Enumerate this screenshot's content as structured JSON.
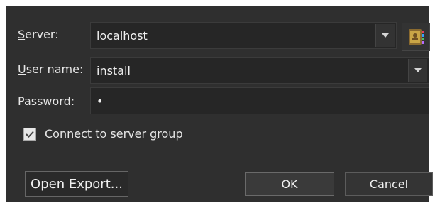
{
  "form": {
    "server": {
      "label_mnemonic": "S",
      "label_rest": "erver:",
      "value": "localhost"
    },
    "username": {
      "label_mnemonic": "U",
      "label_rest": "ser name:",
      "value": "install"
    },
    "password": {
      "label_mnemonic": "P",
      "label_rest": "assword:",
      "value": "•"
    }
  },
  "checkbox": {
    "checked": true,
    "label_before": "Connect to server ",
    "label_mnemonic": "g",
    "label_after": "roup"
  },
  "buttons": {
    "open_export": "Open Export...",
    "ok": "OK",
    "cancel": "Cancel"
  },
  "icons": {
    "dropdown": "chevron-down-icon",
    "address_book": "address-book-icon",
    "checkmark": "checkmark-icon"
  },
  "colors": {
    "dialog_bg": "#2f2f2f",
    "field_bg": "#262626",
    "text": "#e6e6e6"
  }
}
